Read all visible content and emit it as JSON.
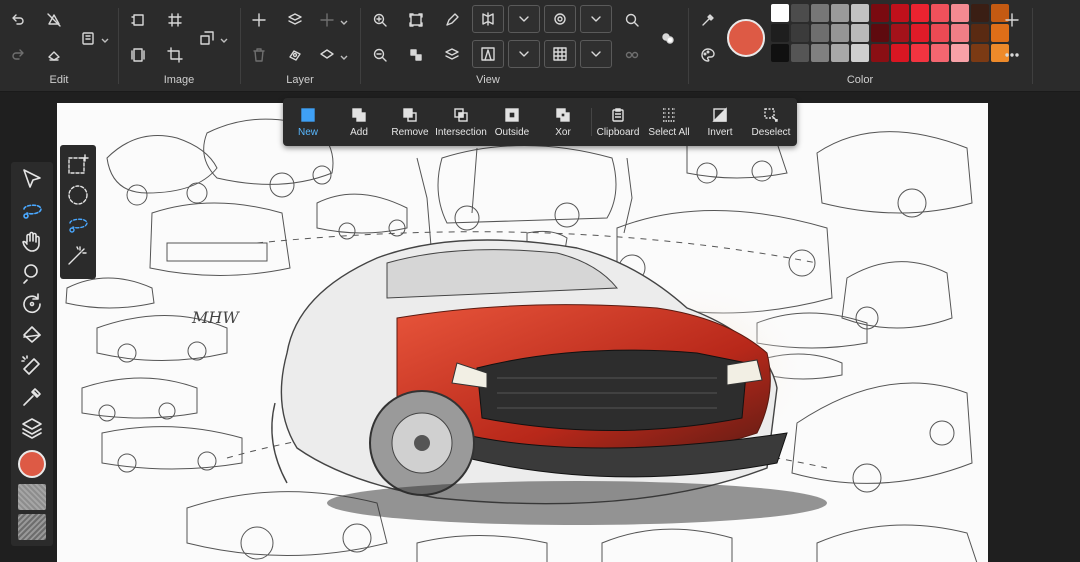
{
  "ribbon": {
    "groups": {
      "edit": "Edit",
      "image": "Image",
      "layer": "Layer",
      "view": "View",
      "color": "Color"
    }
  },
  "selection_bar": {
    "items": [
      {
        "label": "New",
        "icon": "new-selection-icon",
        "active": true
      },
      {
        "label": "Add",
        "icon": "add-selection-icon"
      },
      {
        "label": "Remove",
        "icon": "remove-selection-icon"
      },
      {
        "label": "Intersection",
        "icon": "intersection-icon"
      },
      {
        "label": "Outside",
        "icon": "outside-icon"
      },
      {
        "label": "Xor",
        "icon": "xor-icon"
      },
      {
        "label": "Clipboard",
        "icon": "clipboard-icon"
      },
      {
        "label": "Select All",
        "icon": "select-all-icon"
      },
      {
        "label": "Invert",
        "icon": "invert-icon"
      },
      {
        "label": "Deselect",
        "icon": "deselect-icon"
      }
    ]
  },
  "colors": {
    "current": "#dd5a45",
    "accent": "#4aa8ff",
    "palette_row1": [
      "#ffffff",
      "#4c4c4c",
      "#777777",
      "#9a9a9a",
      "#c2c2c2",
      "#7a0a10",
      "#c0101b",
      "#ea2330",
      "#f0515b",
      "#f48a91",
      "#3a1e14",
      "#c45a12"
    ],
    "palette_row2": [
      "#1e1e1e",
      "#3b3b3b",
      "#6e6e6e",
      "#959595",
      "#b9b9b9",
      "#5e0a0e",
      "#a3121a",
      "#e01b28",
      "#ec4a54",
      "#f07e86",
      "#5a2a12",
      "#de6e18"
    ],
    "palette_row3": [
      "#101010",
      "#555555",
      "#808080",
      "#a8a8a8",
      "#cfcfcf",
      "#8a0f14",
      "#d81622",
      "#f23440",
      "#f46670",
      "#f7a1a7",
      "#7b3a14",
      "#ee8a2a"
    ]
  },
  "left_tools": [
    "pointer-icon",
    "lasso-select-icon",
    "hand-icon",
    "zoom-icon",
    "rotate-icon",
    "fill-bucket-icon",
    "eraser-icon",
    "eyedropper-icon",
    "layers-icon"
  ],
  "sub_tools": [
    "rectangle-select-icon",
    "ellipse-select-icon",
    "lasso-icon",
    "magic-wand-icon"
  ]
}
